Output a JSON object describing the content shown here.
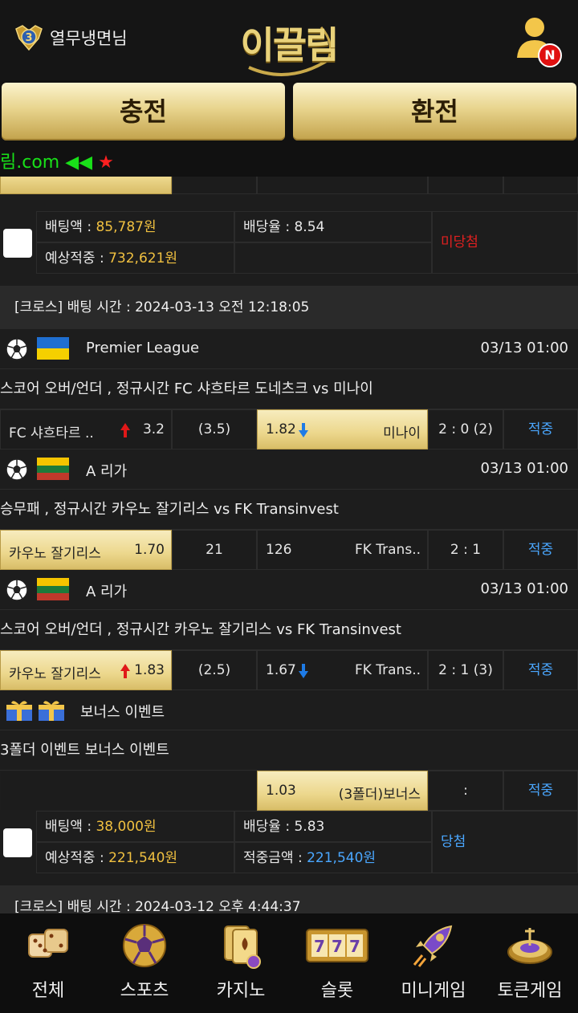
{
  "header": {
    "username": "열무냉면님",
    "logo_text": "이끌림",
    "notification_badge": "N",
    "rank_number": "3"
  },
  "buttons": {
    "charge": "충전",
    "exchange": "환전"
  },
  "marquee": {
    "text": "림.com ◀◀",
    "star": "★"
  },
  "prev_bet": {
    "bet_amount_label": "배팅액 : ",
    "bet_amount": "85,787원",
    "odds_label": "배당율 : ",
    "odds": "8.54",
    "expected_label": "예상적중 : ",
    "expected": "732,621원",
    "status": "미당첨",
    "status_color": "#e02020"
  },
  "cross_bet_1": {
    "header": "[크로스] 배팅 시간 : 2024-03-13 오전 12:18:05",
    "games": [
      {
        "league": "Premier League",
        "time": "03/13 01:00",
        "flag": "ukraine",
        "title": "스코어 오버/언더 , 정규시간 FC 샤흐타르 도네츠크  vs  미나이",
        "home": "FC 샤흐타르 ..",
        "home_odds": "3.2",
        "home_arrow": "up",
        "mid": "(3.5)",
        "away": "미나이",
        "away_odds": "1.82",
        "away_arrow": "down",
        "selected": "away",
        "score": "2 : 0 (2)",
        "result": "적중"
      },
      {
        "league": "A 리가",
        "time": "03/13 01:00",
        "flag": "lithuania",
        "title": "승무패 , 정규시간 카우노 잘기리스  vs  FK Transinvest",
        "home": "카우노 잘기리스",
        "home_odds": "1.70",
        "home_arrow": "",
        "mid": "21",
        "away": "FK Trans..",
        "away_odds": "126",
        "away_arrow": "",
        "selected": "home",
        "score": "2 : 1",
        "result": "적중"
      },
      {
        "league": "A 리가",
        "time": "03/13 01:00",
        "flag": "lithuania",
        "title": "스코어 오버/언더 , 정규시간 카우노 잘기리스  vs  FK Transinvest",
        "home": "카우노 잘기리스",
        "home_odds": "1.83",
        "home_arrow": "up",
        "mid": "(2.5)",
        "away": "FK Trans..",
        "away_odds": "1.67",
        "away_arrow": "down",
        "selected": "home",
        "score": "2 : 1 (3)",
        "result": "적중"
      }
    ],
    "bonus": {
      "league": "보너스 이벤트",
      "title": "3폴더 이벤트 보너스 이벤트",
      "odds": "1.03",
      "label": "(3폴더)보너스",
      "score": ":",
      "result": "적중"
    },
    "summary": {
      "bet_amount_label": "배팅액 : ",
      "bet_amount": "38,000원",
      "odds_label": "배당율 : ",
      "odds": "5.83",
      "expected_label": "예상적중 : ",
      "expected": "221,540원",
      "win_label": "적중금액 : ",
      "win_amount": "221,540원",
      "status": "당첨"
    }
  },
  "cross_bet_2": {
    "header": "[크로스] 배팅 시간 : 2024-03-12 오후 4:44:37"
  },
  "bottom_nav": [
    {
      "label": "전체",
      "icon": "dice-icon"
    },
    {
      "label": "스포츠",
      "icon": "soccer-ball-icon"
    },
    {
      "label": "카지노",
      "icon": "cards-icon"
    },
    {
      "label": "슬롯",
      "icon": "slot-777-icon"
    },
    {
      "label": "미니게임",
      "icon": "rocket-icon"
    },
    {
      "label": "토큰게임",
      "icon": "roulette-icon"
    }
  ],
  "colors": {
    "gold": "#ecd78c",
    "result_blue": "#4aa7ff",
    "amount_yellow": "#f0c040",
    "marquee_green": "#19e019"
  }
}
